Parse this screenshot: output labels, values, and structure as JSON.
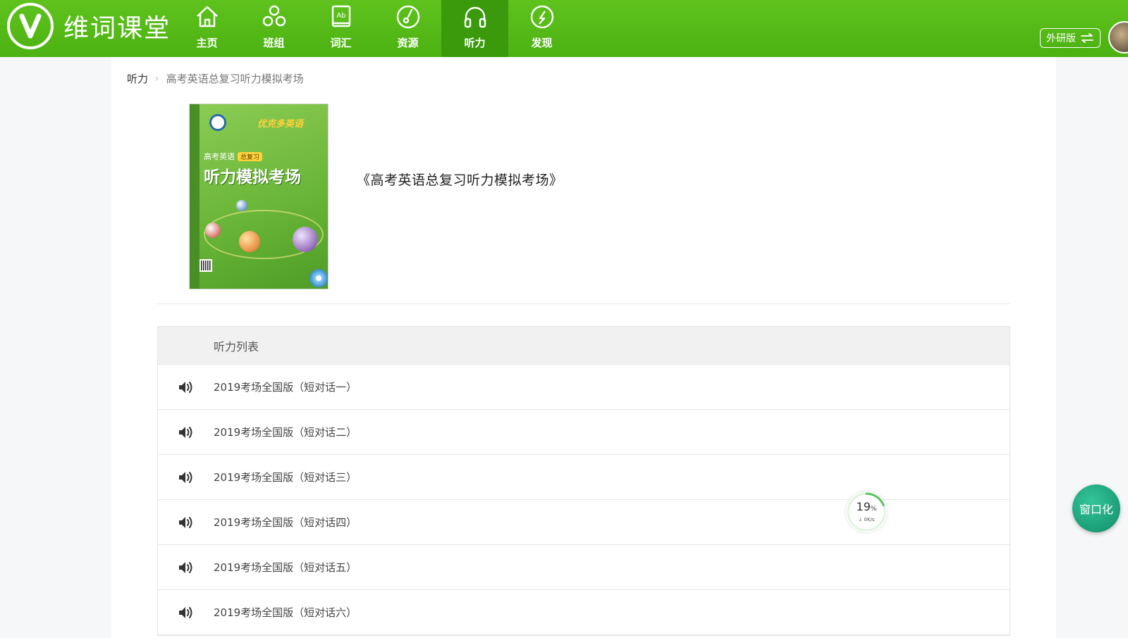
{
  "app": {
    "name": "维词课堂"
  },
  "nav": {
    "items": [
      {
        "label": "主页",
        "icon": "home-icon"
      },
      {
        "label": "班组",
        "icon": "group-icon"
      },
      {
        "label": "词汇",
        "icon": "vocabulary-book-icon"
      },
      {
        "label": "资源",
        "icon": "resource-icon"
      },
      {
        "label": "听力",
        "icon": "headphones-icon",
        "active": true
      },
      {
        "label": "发现",
        "icon": "compass-icon"
      }
    ]
  },
  "header": {
    "edition_label": "外研版"
  },
  "breadcrumb": {
    "root": "听力",
    "current": "高考英语总复习听力模拟考场"
  },
  "book": {
    "title": "《高考英语总复习听力模拟考场》",
    "cover": {
      "brand": "优克多英语",
      "subtitle": "高考英语",
      "tag": "总复习",
      "title": "听力模拟考场"
    }
  },
  "list": {
    "header": "听力列表",
    "items": [
      "2019考场全国版（短对话一）",
      "2019考场全国版（短对话二）",
      "2019考场全国版（短对话三）",
      "2019考场全国版（短对话四）",
      "2019考场全国版（短对话五）",
      "2019考场全国版（短对话六）"
    ]
  },
  "network_widget": {
    "percent": "19",
    "percent_unit": "%",
    "speed": "0K/s",
    "progress_fraction": 0.19
  },
  "window_button": {
    "label": "窗口化"
  },
  "colors": {
    "brand_green": "#4cb212",
    "active_nav": "#3a9a0c",
    "window_button": "#1a9e78"
  }
}
